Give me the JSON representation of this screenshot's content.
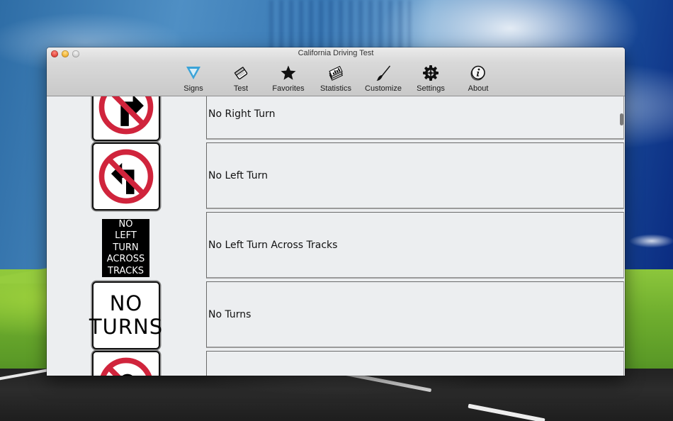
{
  "window": {
    "title": "California Driving Test"
  },
  "toolbar": {
    "items": [
      {
        "label": "Signs",
        "icon": "yield-sign-icon",
        "selected": true,
        "accent": "#3aa3d8"
      },
      {
        "label": "Test",
        "icon": "test-paper-icon"
      },
      {
        "label": "Favorites",
        "icon": "star-icon"
      },
      {
        "label": "Statistics",
        "icon": "statistics-icon"
      },
      {
        "label": "Customize",
        "icon": "brush-icon"
      },
      {
        "label": "Settings",
        "icon": "gear-icon"
      },
      {
        "label": "About",
        "icon": "info-icon"
      }
    ]
  },
  "signs_list": {
    "rows": [
      {
        "name": "No Right Turn",
        "sign": "no-right-turn-sign"
      },
      {
        "name": "No Left Turn",
        "sign": "no-left-turn-sign"
      },
      {
        "name": "No Left Turn Across Tracks",
        "sign": "no-left-turn-across-tracks-sign",
        "sign_text": [
          "NO",
          "LEFT",
          "TURN",
          "ACROSS",
          "TRACKS"
        ]
      },
      {
        "name": "No Turns",
        "sign": "no-turns-sign",
        "sign_text": [
          "NO",
          "TURNS"
        ]
      },
      {
        "name": "",
        "sign": "no-u-turn-sign"
      }
    ]
  },
  "colors": {
    "prohibition_red": "#d0243c",
    "signs_icon_blue": "#3aa3d8"
  }
}
